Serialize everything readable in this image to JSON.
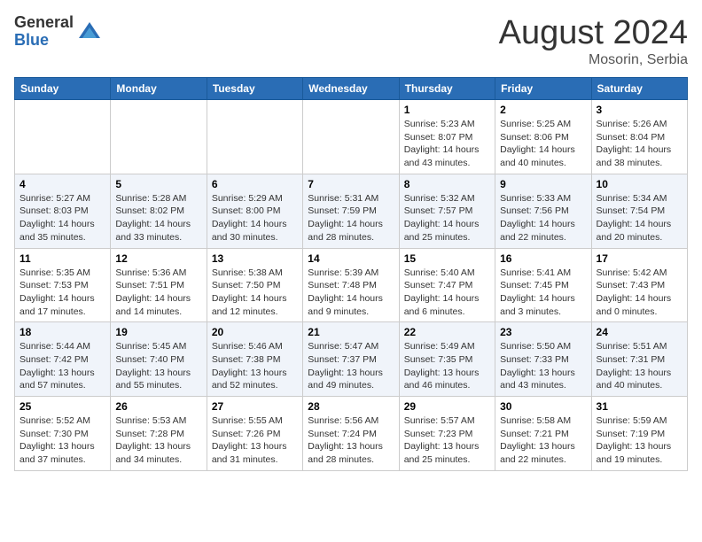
{
  "header": {
    "logo_general": "General",
    "logo_blue": "Blue",
    "month_year": "August 2024",
    "location": "Mosorin, Serbia"
  },
  "days_of_week": [
    "Sunday",
    "Monday",
    "Tuesday",
    "Wednesday",
    "Thursday",
    "Friday",
    "Saturday"
  ],
  "weeks": [
    [
      {
        "day": "",
        "info": ""
      },
      {
        "day": "",
        "info": ""
      },
      {
        "day": "",
        "info": ""
      },
      {
        "day": "",
        "info": ""
      },
      {
        "day": "1",
        "info": "Sunrise: 5:23 AM\nSunset: 8:07 PM\nDaylight: 14 hours\nand 43 minutes."
      },
      {
        "day": "2",
        "info": "Sunrise: 5:25 AM\nSunset: 8:06 PM\nDaylight: 14 hours\nand 40 minutes."
      },
      {
        "day": "3",
        "info": "Sunrise: 5:26 AM\nSunset: 8:04 PM\nDaylight: 14 hours\nand 38 minutes."
      }
    ],
    [
      {
        "day": "4",
        "info": "Sunrise: 5:27 AM\nSunset: 8:03 PM\nDaylight: 14 hours\nand 35 minutes."
      },
      {
        "day": "5",
        "info": "Sunrise: 5:28 AM\nSunset: 8:02 PM\nDaylight: 14 hours\nand 33 minutes."
      },
      {
        "day": "6",
        "info": "Sunrise: 5:29 AM\nSunset: 8:00 PM\nDaylight: 14 hours\nand 30 minutes."
      },
      {
        "day": "7",
        "info": "Sunrise: 5:31 AM\nSunset: 7:59 PM\nDaylight: 14 hours\nand 28 minutes."
      },
      {
        "day": "8",
        "info": "Sunrise: 5:32 AM\nSunset: 7:57 PM\nDaylight: 14 hours\nand 25 minutes."
      },
      {
        "day": "9",
        "info": "Sunrise: 5:33 AM\nSunset: 7:56 PM\nDaylight: 14 hours\nand 22 minutes."
      },
      {
        "day": "10",
        "info": "Sunrise: 5:34 AM\nSunset: 7:54 PM\nDaylight: 14 hours\nand 20 minutes."
      }
    ],
    [
      {
        "day": "11",
        "info": "Sunrise: 5:35 AM\nSunset: 7:53 PM\nDaylight: 14 hours\nand 17 minutes."
      },
      {
        "day": "12",
        "info": "Sunrise: 5:36 AM\nSunset: 7:51 PM\nDaylight: 14 hours\nand 14 minutes."
      },
      {
        "day": "13",
        "info": "Sunrise: 5:38 AM\nSunset: 7:50 PM\nDaylight: 14 hours\nand 12 minutes."
      },
      {
        "day": "14",
        "info": "Sunrise: 5:39 AM\nSunset: 7:48 PM\nDaylight: 14 hours\nand 9 minutes."
      },
      {
        "day": "15",
        "info": "Sunrise: 5:40 AM\nSunset: 7:47 PM\nDaylight: 14 hours\nand 6 minutes."
      },
      {
        "day": "16",
        "info": "Sunrise: 5:41 AM\nSunset: 7:45 PM\nDaylight: 14 hours\nand 3 minutes."
      },
      {
        "day": "17",
        "info": "Sunrise: 5:42 AM\nSunset: 7:43 PM\nDaylight: 14 hours\nand 0 minutes."
      }
    ],
    [
      {
        "day": "18",
        "info": "Sunrise: 5:44 AM\nSunset: 7:42 PM\nDaylight: 13 hours\nand 57 minutes."
      },
      {
        "day": "19",
        "info": "Sunrise: 5:45 AM\nSunset: 7:40 PM\nDaylight: 13 hours\nand 55 minutes."
      },
      {
        "day": "20",
        "info": "Sunrise: 5:46 AM\nSunset: 7:38 PM\nDaylight: 13 hours\nand 52 minutes."
      },
      {
        "day": "21",
        "info": "Sunrise: 5:47 AM\nSunset: 7:37 PM\nDaylight: 13 hours\nand 49 minutes."
      },
      {
        "day": "22",
        "info": "Sunrise: 5:49 AM\nSunset: 7:35 PM\nDaylight: 13 hours\nand 46 minutes."
      },
      {
        "day": "23",
        "info": "Sunrise: 5:50 AM\nSunset: 7:33 PM\nDaylight: 13 hours\nand 43 minutes."
      },
      {
        "day": "24",
        "info": "Sunrise: 5:51 AM\nSunset: 7:31 PM\nDaylight: 13 hours\nand 40 minutes."
      }
    ],
    [
      {
        "day": "25",
        "info": "Sunrise: 5:52 AM\nSunset: 7:30 PM\nDaylight: 13 hours\nand 37 minutes."
      },
      {
        "day": "26",
        "info": "Sunrise: 5:53 AM\nSunset: 7:28 PM\nDaylight: 13 hours\nand 34 minutes."
      },
      {
        "day": "27",
        "info": "Sunrise: 5:55 AM\nSunset: 7:26 PM\nDaylight: 13 hours\nand 31 minutes."
      },
      {
        "day": "28",
        "info": "Sunrise: 5:56 AM\nSunset: 7:24 PM\nDaylight: 13 hours\nand 28 minutes."
      },
      {
        "day": "29",
        "info": "Sunrise: 5:57 AM\nSunset: 7:23 PM\nDaylight: 13 hours\nand 25 minutes."
      },
      {
        "day": "30",
        "info": "Sunrise: 5:58 AM\nSunset: 7:21 PM\nDaylight: 13 hours\nand 22 minutes."
      },
      {
        "day": "31",
        "info": "Sunrise: 5:59 AM\nSunset: 7:19 PM\nDaylight: 13 hours\nand 19 minutes."
      }
    ]
  ]
}
